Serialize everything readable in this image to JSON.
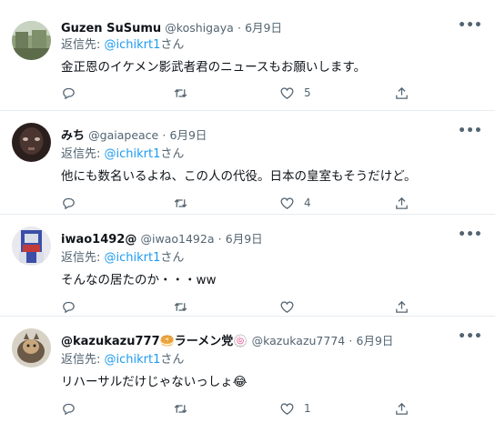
{
  "tweets": [
    {
      "name": "Guzen SuSumu",
      "handle": "@koshigaya",
      "sep": "·",
      "date": "6月9日",
      "reply_prefix": "返信先: ",
      "reply_handle": "@ichikrt1",
      "reply_suffix": "さん",
      "text": "金正恩のイケメン影武者君のニュースもお願いします。",
      "likes": "5",
      "more": "•••"
    },
    {
      "name": "みち",
      "handle": "@gaiapeace",
      "sep": "·",
      "date": "6月9日",
      "reply_prefix": "返信先: ",
      "reply_handle": "@ichikrt1",
      "reply_suffix": "さん",
      "text": "他にも数名いるよね、この人の代役。日本の皇室もそうだけど。",
      "likes": "4",
      "more": "•••"
    },
    {
      "name": "iwao1492@",
      "handle": "@iwao1492a",
      "sep": "·",
      "date": "6月9日",
      "reply_prefix": "返信先: ",
      "reply_handle": "@ichikrt1",
      "reply_suffix": "さん",
      "text": "そんなの居たのか・・・ww",
      "likes": "",
      "more": "•••"
    },
    {
      "name": "@kazukazu777🥯ラーメン党🍥",
      "handle": "@kazukazu7774",
      "sep": "·",
      "date": "6月9日",
      "reply_prefix": "返信先: ",
      "reply_handle": "@ichikrt1",
      "reply_suffix": "さん",
      "text": "リハーサルだけじゃないっしょ😂",
      "likes": "1",
      "more": "•••"
    }
  ],
  "icons": {
    "reply": "reply-icon",
    "retweet": "retweet-icon",
    "like": "heart-icon",
    "share": "share-icon"
  },
  "colors": {
    "link": "#1d9bf0",
    "secondary": "#536471",
    "divider": "#e6ecf0"
  }
}
